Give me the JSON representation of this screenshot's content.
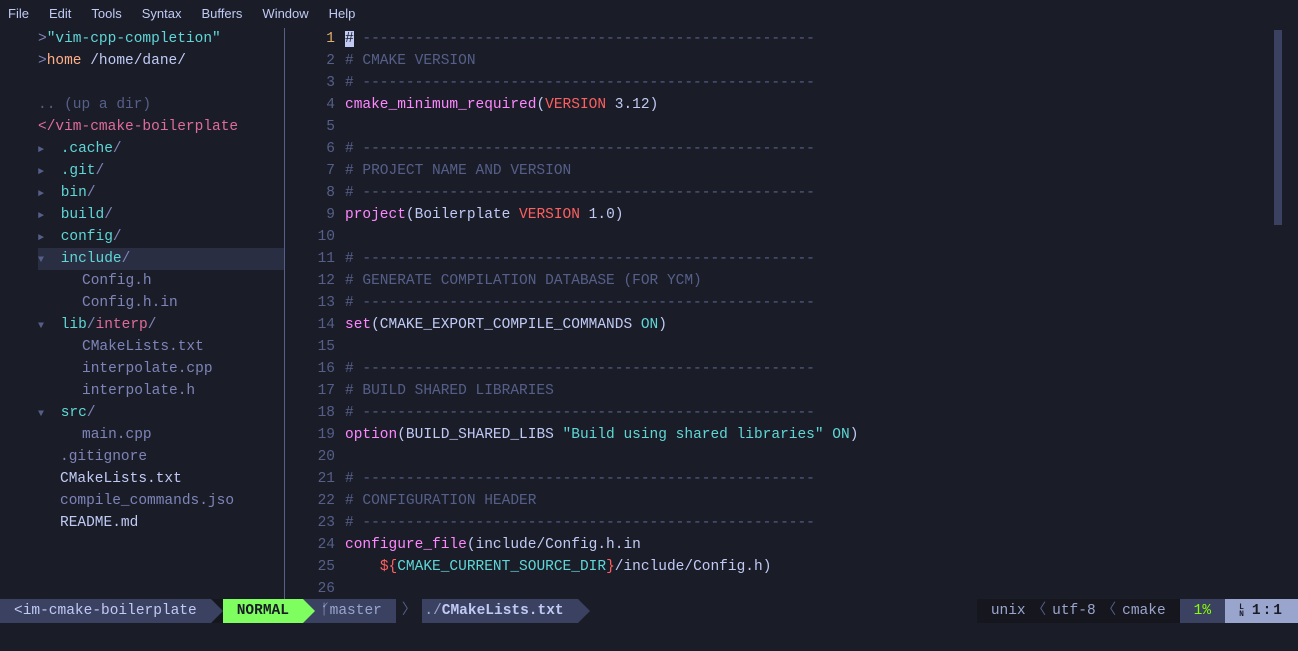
{
  "menu": [
    "File",
    "Edit",
    "Tools",
    "Syntax",
    "Buffers",
    "Window",
    "Help"
  ],
  "sidebar": {
    "proj_label": "\"vim-cpp-completion\"",
    "home_label": "home",
    "home_path": "/home/dane/",
    "updir": ".. (up a dir)",
    "root": "</vim-cmake-boilerplate",
    "items": [
      {
        "t": "d",
        "exp": "►",
        "name": ".cache",
        "sub": ""
      },
      {
        "t": "d",
        "exp": "►",
        "name": ".git",
        "sub": ""
      },
      {
        "t": "d",
        "exp": "►",
        "name": "bin",
        "sub": ""
      },
      {
        "t": "d",
        "exp": "►",
        "name": "build",
        "sub": ""
      },
      {
        "t": "d",
        "exp": "►",
        "name": "config",
        "sub": ""
      },
      {
        "t": "d",
        "exp": "▼",
        "name": "include",
        "sub": "",
        "hi": true
      },
      {
        "t": "f",
        "name": "Config.h"
      },
      {
        "t": "f",
        "name": "Config.h.in"
      },
      {
        "t": "d",
        "exp": "▼",
        "name": "lib",
        "sub": "interp"
      },
      {
        "t": "f",
        "name": "CMakeLists.txt"
      },
      {
        "t": "f",
        "name": "interpolate.cpp"
      },
      {
        "t": "f",
        "name": "interpolate.h"
      },
      {
        "t": "d",
        "exp": "▼",
        "name": "src",
        "sub": ""
      },
      {
        "t": "f",
        "name": "main.cpp"
      },
      {
        "t": "f",
        "name": ".gitignore",
        "root": true
      },
      {
        "t": "f",
        "name": "CMakeLists.txt",
        "root": true,
        "w": true
      },
      {
        "t": "f",
        "name": "compile_commands.jso",
        "root": true
      },
      {
        "t": "f",
        "name": "README.md",
        "root": true,
        "w": true
      }
    ]
  },
  "code": {
    "dashes": "----------------------------------------------------",
    "l1": "# ",
    "l2": "# CMAKE VERSION",
    "l4": {
      "fn": "cmake_minimum_required",
      "kw": "VERSION",
      "arg": " 3.12"
    },
    "l7": "# PROJECT NAME AND VERSION",
    "l9": {
      "fn": "project",
      "arg1": "Boilerplate ",
      "kw": "VERSION",
      "arg2": " 1.0"
    },
    "l12": "# GENERATE COMPILATION DATABASE (FOR YCM)",
    "l14": {
      "fn": "set",
      "arg": "CMAKE_EXPORT_COMPILE_COMMANDS",
      "on": "ON"
    },
    "l17": "# BUILD SHARED LIBRARIES",
    "l19": {
      "fn": "option",
      "arg": "BUILD_SHARED_LIBS",
      "str": "\"Build using shared libraries\"",
      "on": "ON"
    },
    "l22": "# CONFIGURATION HEADER",
    "l24": {
      "fn": "configure_file",
      "arg": "include/Config.h.in"
    },
    "l25": {
      "pre": "    ",
      "bo": "${",
      "var": "CMAKE_CURRENT_SOURCE_DIR",
      "bc": "}",
      "rest": "/include/Config.h)"
    }
  },
  "status": {
    "cwd": "<im-cmake-boilerplate",
    "mode": "NORMAL",
    "branch": "master",
    "pathdir": "./",
    "pathfile": "CMakeLists.txt",
    "os": "unix",
    "enc": "utf-8",
    "ft": "cmake",
    "pct": "1%",
    "pos": "1:1"
  }
}
